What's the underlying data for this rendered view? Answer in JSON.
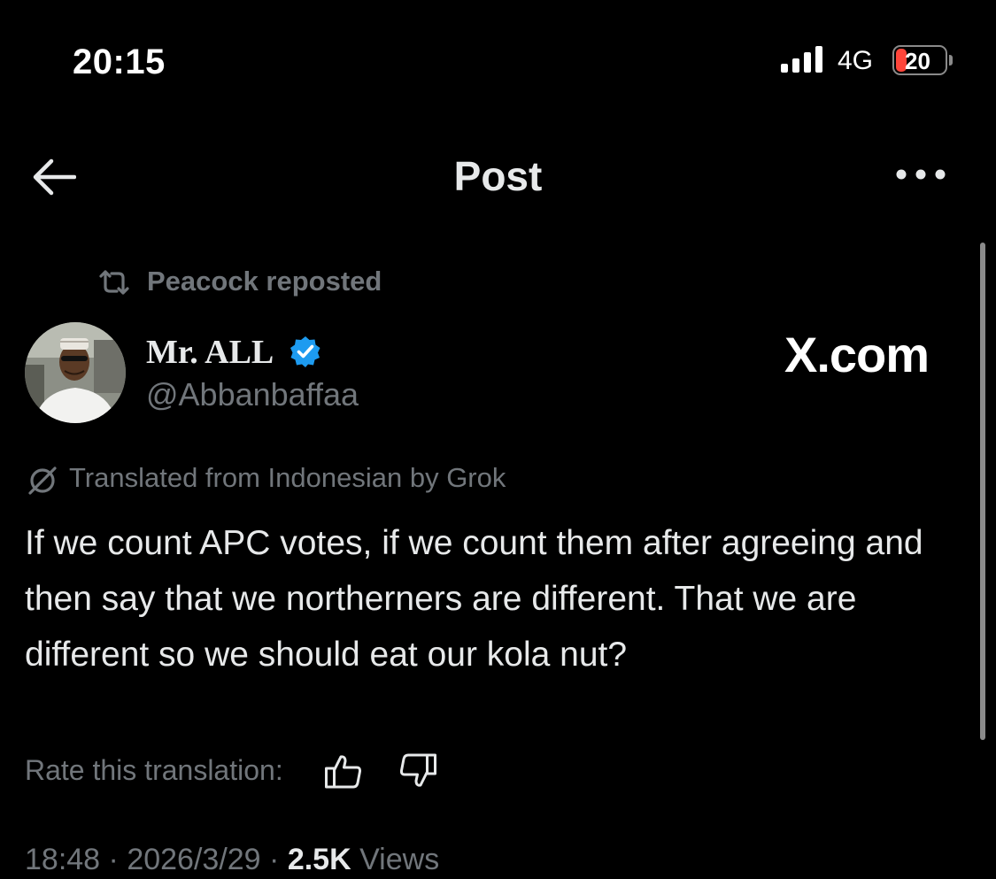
{
  "status_bar": {
    "time": "20:15",
    "network": "4G",
    "battery": "20",
    "battery_color": "#ff453a"
  },
  "header": {
    "title": "Post",
    "back_icon": "arrow-left-icon",
    "more_icon": "more-horizontal-icon"
  },
  "post": {
    "repost_label": "Peacock reposted",
    "author": {
      "name": "Mr. ALL",
      "handle": "@Abbanbaffaa",
      "verified": true,
      "verified_color": "#1d9bf0"
    },
    "watermark": "X.com",
    "translation_note": "Translated from Indonesian by Grok",
    "text": "If we count APC votes, if we count them after agreeing and then say that we northerners are different. That we are different so we should eat our kola nut?",
    "rate_label": "Rate this translation:",
    "time": "18:48",
    "date": "2026/3/29",
    "views_count": "2.5K",
    "views_label": "Views",
    "separator": "·"
  },
  "colors": {
    "background": "#000000",
    "text_primary": "#e7e9ea",
    "text_secondary": "#71767b"
  }
}
